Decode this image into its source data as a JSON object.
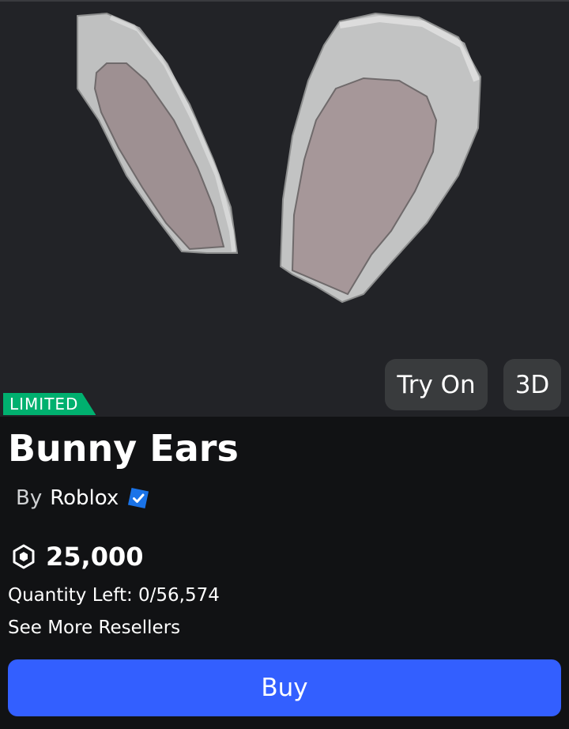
{
  "item": {
    "badge": "LIMITED",
    "title": "Bunny Ears",
    "creator_prefix": "By",
    "creator_name": "Roblox",
    "price": "25,000",
    "quantity_left": "Quantity Left: 0/56,574",
    "see_more": "See More Resellers"
  },
  "preview": {
    "try_on_label": "Try On",
    "view_3d_label": "3D"
  },
  "actions": {
    "buy_label": "Buy"
  },
  "icons": {
    "currency": "robux-icon",
    "verified": "verified-badge-icon"
  },
  "colors": {
    "buy": "#335fff",
    "limited": "#00b06f",
    "verified": "#1a73e8"
  }
}
